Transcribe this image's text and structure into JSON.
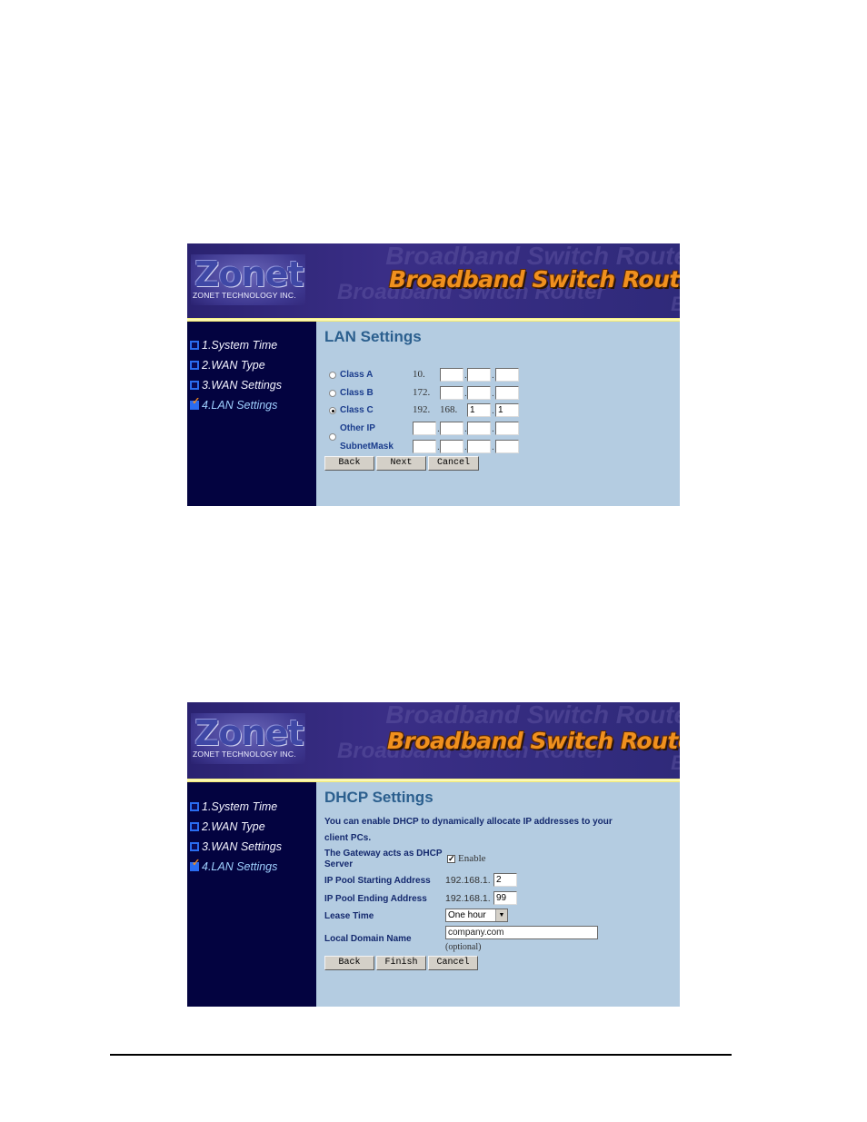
{
  "brand": {
    "logo_text": "Zonet",
    "company": "ZONET TECHNOLOGY INC.",
    "product": "Broadband Switch Router",
    "colors": {
      "header": "#2f2a7a",
      "sidebar": "#030340",
      "content": "#b4cce1",
      "accent_rule": "#f4ec6c",
      "title": "#2b5f8e"
    }
  },
  "sidebar": {
    "items": [
      {
        "label": "1.System Time",
        "checked": false
      },
      {
        "label": "2.WAN Type",
        "checked": false
      },
      {
        "label": "3.WAN Settings",
        "checked": false
      },
      {
        "label": "4.LAN Settings",
        "checked": true
      }
    ]
  },
  "lan": {
    "title": "LAN Settings",
    "options": [
      {
        "label": "Class A",
        "selected": false,
        "prefix": "10.",
        "fields": [
          "",
          "",
          ""
        ]
      },
      {
        "label": "Class B",
        "selected": false,
        "prefix": "172.",
        "fields": [
          "",
          "",
          ""
        ]
      },
      {
        "label": "Class C",
        "selected": true,
        "prefix": "192.",
        "prefix2": "168.",
        "fields": [
          "1",
          "1"
        ]
      }
    ],
    "other": {
      "selected": false,
      "ip_label": "Other IP",
      "mask_label": "SubnetMask",
      "ip_fields": [
        "",
        "",
        "",
        ""
      ],
      "mask_fields": [
        "",
        "",
        "",
        ""
      ]
    },
    "buttons": {
      "back": "Back",
      "next": "Next",
      "cancel": "Cancel"
    }
  },
  "dhcp": {
    "title": "DHCP Settings",
    "intro_line1": "You can enable DHCP to dynamically allocate IP addresses to your",
    "intro_line2": "client PCs.",
    "gateway_label_1": "The Gateway acts as DHCP",
    "gateway_label_2": "Server",
    "enable_label": "Enable",
    "enable_checked": true,
    "start_label": "IP Pool Starting Address",
    "start_prefix": "192.168.1.",
    "start_value": "2",
    "end_label": "IP Pool Ending Address",
    "end_prefix": "192.168.1.",
    "end_value": "99",
    "lease_label": "Lease Time",
    "lease_value": "One hour",
    "domain_label": "Local Domain Name",
    "domain_value": "company.com",
    "domain_hint": "(optional)",
    "buttons": {
      "back": "Back",
      "finish": "Finish",
      "cancel": "Cancel"
    }
  }
}
